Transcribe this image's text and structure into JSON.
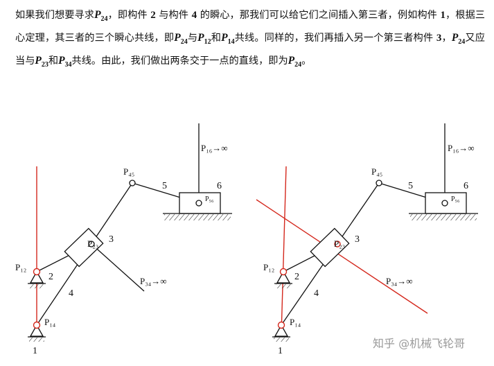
{
  "text": {
    "s1": "如果我们想要寻求",
    "p24a": "P",
    "p24a_sub": "24",
    "s2": "，即构件 ",
    "n2": "2",
    "s3": " 与构件 ",
    "n4": "4",
    "s4": " 的瞬心，那我们可以给它们之间插入第三者，例如构件 ",
    "n1": "1",
    "s5": "，根据三心定理，其三者的三个瞬心共线，即",
    "p24b": "P",
    "p24b_sub": "24",
    "s6": "与",
    "p12": "P",
    "p12_sub": "12",
    "s7": "和",
    "p14": "P",
    "p14_sub": "14",
    "s8": "共线。同样的，我们再插入另一个第三者构件 ",
    "n3": "3",
    "s9": "，",
    "p24c": "P",
    "p24c_sub": "24",
    "s10": "又应当与",
    "p23": "P",
    "p23_sub": "23",
    "s11": "和",
    "p34": "P",
    "p34_sub": "34",
    "s12": "共线。由此，我们做出两条交于一点的直线，即为",
    "p24d": "P",
    "p24d_sub": "24",
    "s13": "。"
  },
  "figures": {
    "left": {
      "P12": "P₁₂",
      "P14": "P₁₄",
      "P23": "P₂₃",
      "P45": "P₄₅",
      "P56": "P₅₆",
      "P16": "P₁₆→∞",
      "P34": "P₃₄→∞",
      "n1": "1",
      "n2": "2",
      "n3": "3",
      "n4": "4",
      "n5": "5",
      "n6": "6"
    },
    "right": {
      "P12": "P₁₂",
      "P14": "P₁₄",
      "P23": "P₂₃",
      "P45": "P₄₅",
      "P56": "P₅₆",
      "P16": "P₁₆→∞",
      "P34": "P₃₄→∞",
      "n1": "1",
      "n2": "2",
      "n3": "3",
      "n4": "4",
      "n5": "5",
      "n6": "6"
    }
  },
  "watermark": "知乎 @机械飞轮哥",
  "colors": {
    "ink": "#111111",
    "red": "#d4271c",
    "watermark": "#9a9a9a"
  }
}
